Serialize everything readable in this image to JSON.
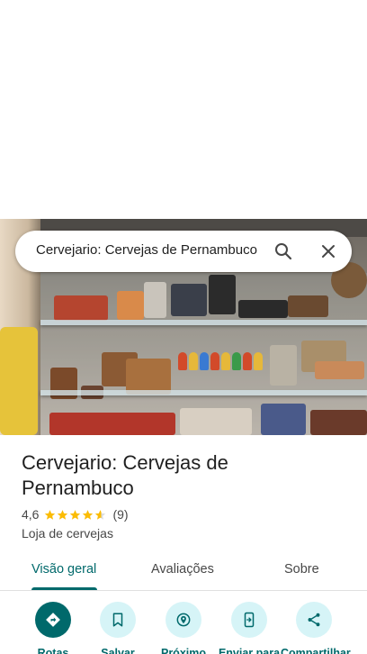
{
  "search": {
    "query": "Cervejario: Cervejas de Pernambuco"
  },
  "place": {
    "name": "Cervejario: Cervejas de Pernambuco",
    "rating": "4,6",
    "rating_stars": 4.6,
    "review_count": "(9)",
    "category": "Loja de cervejas"
  },
  "tabs": [
    {
      "label": "Visão geral",
      "active": true
    },
    {
      "label": "Avaliações",
      "active": false
    },
    {
      "label": "Sobre",
      "active": false
    }
  ],
  "actions": [
    {
      "label": "Rotas",
      "icon": "directions-icon"
    },
    {
      "label": "Salvar",
      "icon": "bookmark-icon"
    },
    {
      "label": "Próximo",
      "icon": "nearby-icon"
    },
    {
      "label": "Enviar para",
      "icon": "send-to-phone-icon"
    },
    {
      "label": "Compartilhar",
      "icon": "share-icon"
    }
  ],
  "colors": {
    "accent": "#00696b",
    "action_bg": "#d6f4f7",
    "star": "#fbbc04"
  }
}
